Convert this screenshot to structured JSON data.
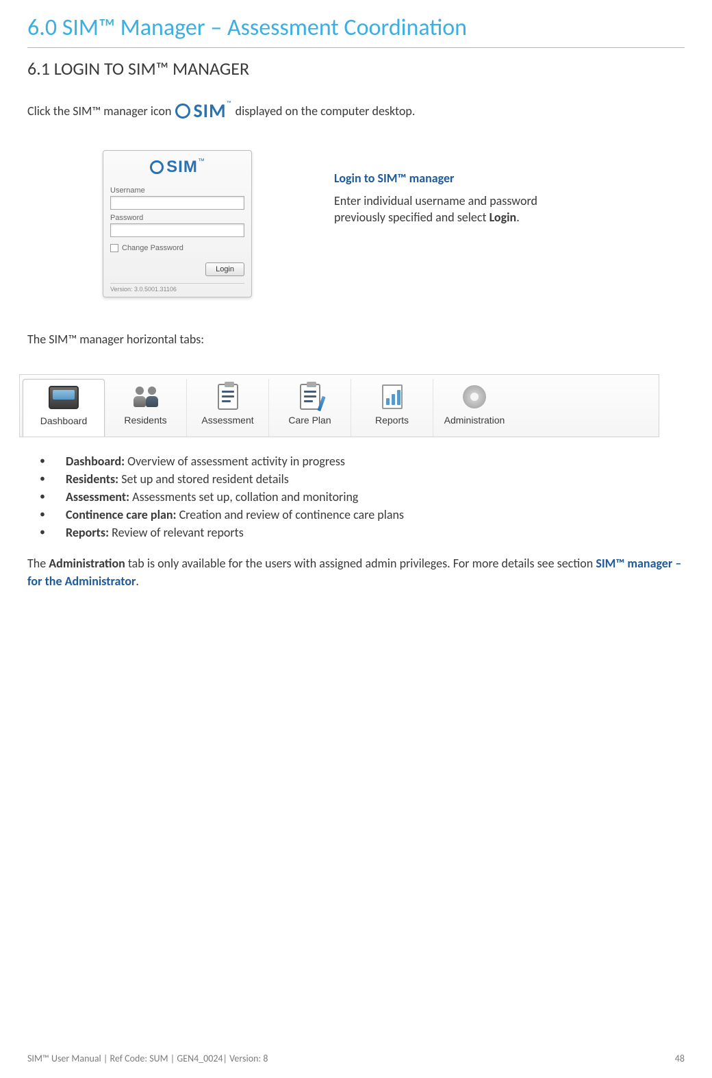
{
  "title": "6.0 SIM™ Manager – Assessment Coordination",
  "section": "6.1 LOGIN TO SIM™ MANAGER",
  "line1_a": "Click the SIM™ manager icon",
  "line1_b": "displayed on the computer desktop.",
  "logo_text": "SIM",
  "login": {
    "username_label": "Username",
    "password_label": "Password",
    "change_pw": "Change Password",
    "button": "Login",
    "version": "Version: 3.0.5001.31106"
  },
  "side": {
    "heading": "Login to SIM™ manager",
    "body_a": "Enter individual username and password previously specified and select ",
    "body_b": "Login",
    "body_c": "."
  },
  "tabs_intro": "The SIM™ manager horizontal tabs:",
  "tabs": {
    "dashboard": "Dashboard",
    "residents": "Residents",
    "assessment": "Assessment",
    "careplan": "Care Plan",
    "reports": "Reports",
    "admin": "Administration"
  },
  "bullets": {
    "b1_t": "Dashboard:",
    "b1_d": " Overview of assessment activity in progress",
    "b2_t": "Residents:",
    "b2_d": " Set up and stored resident details",
    "b3_t": "Assessment:",
    "b3_d": " Assessments set up, collation  and monitoring",
    "b4_t": "Continence care plan:",
    "b4_d": " Creation and review of continence care plans",
    "b5_t": "Reports:",
    "b5_d": " Review of relevant reports"
  },
  "admin_para": {
    "a": "The ",
    "b": "Administration",
    "c": " tab is only available for the users with assigned admin privileges. For more details see section ",
    "d": "SIM™ manager – for the Administrator",
    "e": "."
  },
  "footer": {
    "left": "SIM™ User Manual | Ref Code: SUM | GEN4_0024| Version: 8",
    "right": "48"
  }
}
